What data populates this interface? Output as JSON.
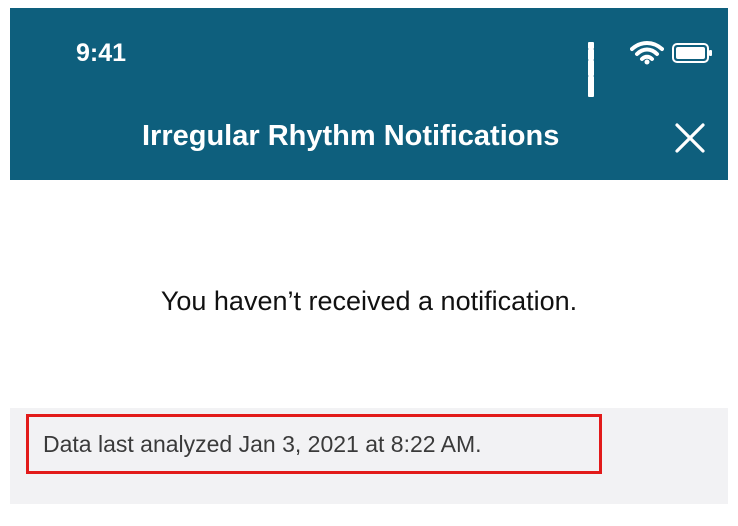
{
  "colors": {
    "header_background": "#0e5f7d",
    "header_text": "#ffffff",
    "highlight_border": "#e21a1a",
    "info_band_background": "#f2f2f4"
  },
  "status_bar": {
    "time": "9:41",
    "icons": [
      "cellular-signal-icon",
      "wifi-icon",
      "battery-icon"
    ]
  },
  "nav": {
    "title": "Irregular Rhythm Notifications",
    "close_icon": "close-icon"
  },
  "content": {
    "message": "You haven’t received a notification."
  },
  "info": {
    "analysis_text": "Data last analyzed Jan 3, 2021 at 8:22 AM."
  }
}
